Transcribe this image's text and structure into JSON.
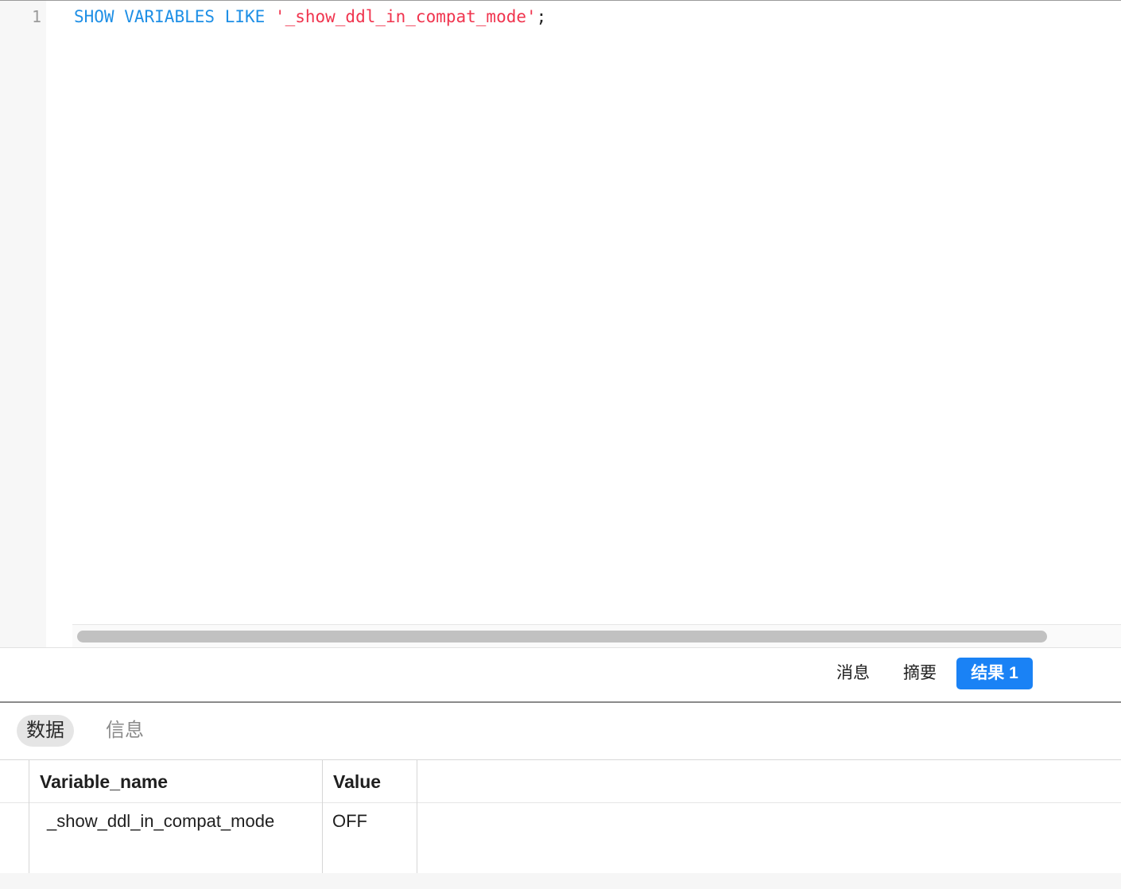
{
  "editor": {
    "line_number": "1",
    "code_tokens": {
      "keyword_show": "SHOW",
      "keyword_variables": "VARIABLES",
      "keyword_like": "LIKE",
      "string_literal": "'_show_ddl_in_compat_mode'",
      "terminator": ";"
    },
    "colors": {
      "keyword": "#1e8fe6",
      "string": "#f0344e"
    }
  },
  "result_tabs": {
    "messages": "消息",
    "summary": "摘要",
    "result1": "结果 1",
    "active_color": "#1a82f5"
  },
  "sub_tabs": {
    "data": "数据",
    "info": "信息"
  },
  "grid": {
    "columns": [
      "Variable_name",
      "Value"
    ],
    "rows": [
      [
        "_show_ddl_in_compat_mode",
        "OFF"
      ]
    ]
  }
}
